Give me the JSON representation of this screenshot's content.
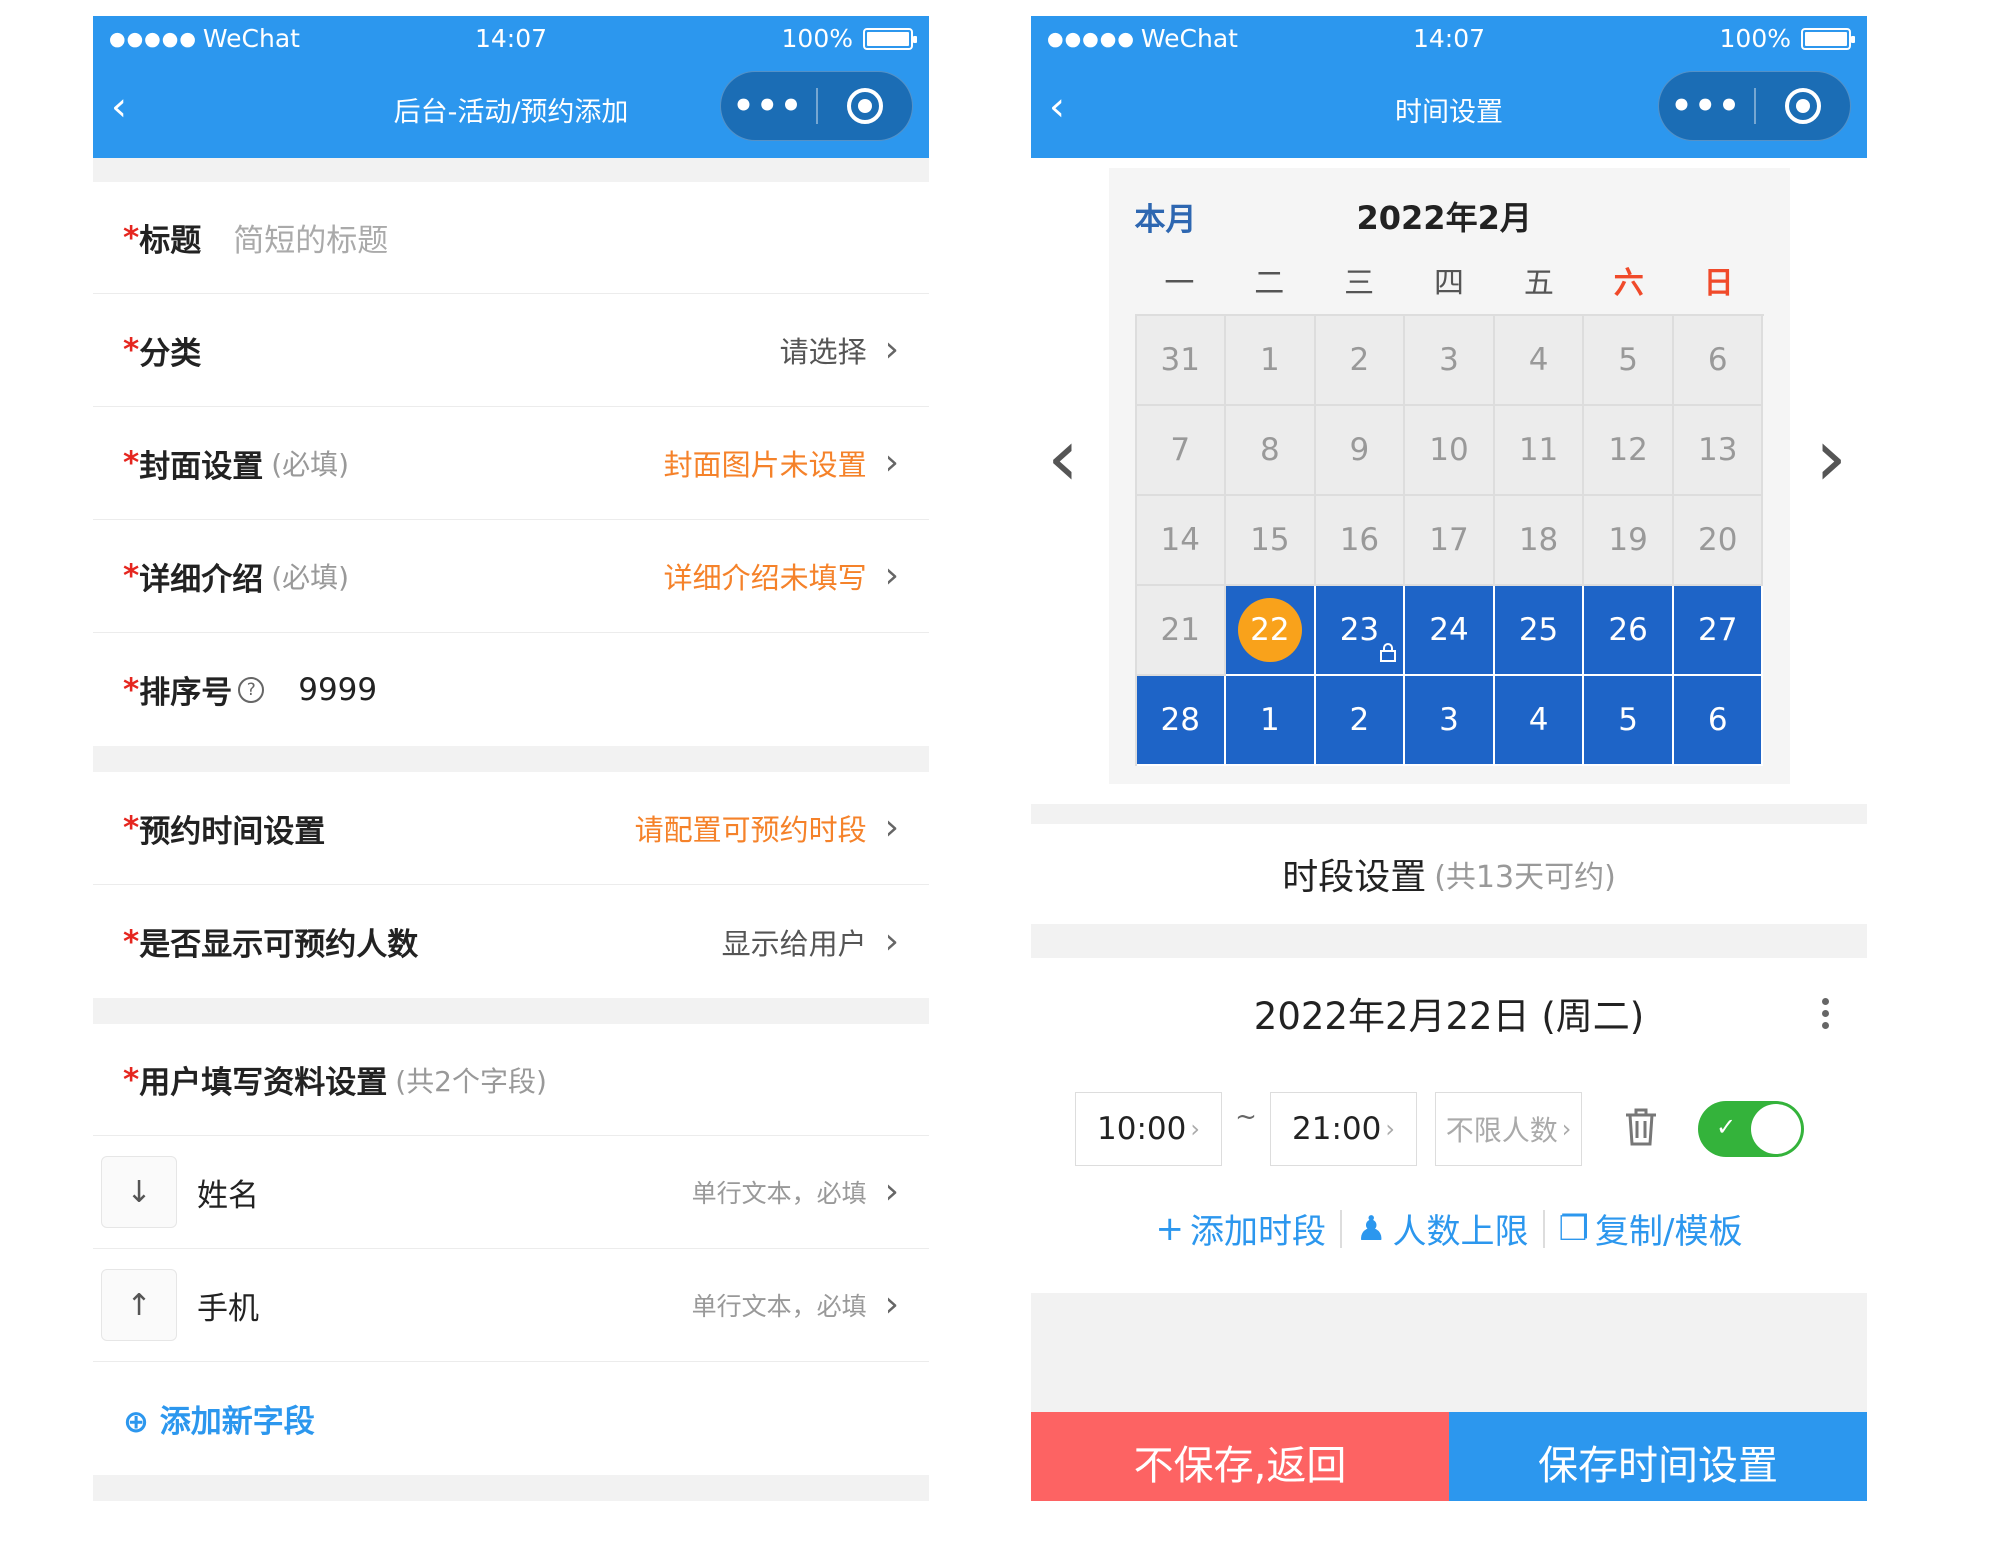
{
  "left": {
    "status": {
      "dots": "●●●●●",
      "carrier": "WeChat",
      "time": "14:07",
      "battery": "100%"
    },
    "nav": {
      "title": "后台-活动/预约添加",
      "more": "•••"
    },
    "form": {
      "title_label": "标题",
      "title_placeholder": "简短的标题",
      "category_label": "分类",
      "category_value": "请选择",
      "cover_label": "封面设置",
      "cover_hint": "(必填)",
      "cover_value": "封面图片未设置",
      "detail_label": "详细介绍",
      "detail_hint": "(必填)",
      "detail_value": "详细介绍未填写",
      "sort_label": "排序号",
      "sort_value": "9999",
      "time_label": "预约时间设置",
      "time_value": "请配置可预约时段",
      "show_label": "是否显示可预约人数",
      "show_value": "显示给用户",
      "fields_label": "用户填写资料设置",
      "fields_count": "(共2个字段)",
      "fields": [
        {
          "arrow": "↓",
          "name": "姓名",
          "type": "单行文本，必填"
        },
        {
          "arrow": "↑",
          "name": "手机",
          "type": "单行文本，必填"
        }
      ],
      "add_field": "添加新字段",
      "star": "*",
      "chevron": "›",
      "help": "?"
    }
  },
  "right": {
    "status": {
      "dots": "●●●●●",
      "carrier": "WeChat",
      "time": "14:07",
      "battery": "100%"
    },
    "nav": {
      "title": "时间设置",
      "more": "•••"
    },
    "calendar": {
      "this_month": "本月",
      "year_month": "2022年2月",
      "weekdays": [
        "一",
        "二",
        "三",
        "四",
        "五",
        "六",
        "日"
      ],
      "days": [
        "31",
        "1",
        "2",
        "3",
        "4",
        "5",
        "6",
        "7",
        "8",
        "9",
        "10",
        "11",
        "12",
        "13",
        "14",
        "15",
        "16",
        "17",
        "18",
        "19",
        "20",
        "21",
        "22",
        "23",
        "24",
        "25",
        "26",
        "27",
        "28",
        "1",
        "2",
        "3",
        "4",
        "5",
        "6"
      ],
      "prev": "‹",
      "next": "›"
    },
    "slots_section": {
      "title": "时段设置",
      "count": "(共13天可约)"
    },
    "day": {
      "date": "2022年2月22日 (周二)",
      "start": "10:00",
      "end": "21:00",
      "tilde": "~",
      "capacity": "不限人数",
      "add_slot": "添加时段",
      "limit": "人数上限",
      "copy": "复制/模板"
    },
    "buttons": {
      "cancel": "不保存,返回",
      "save": "保存时间设置"
    }
  }
}
